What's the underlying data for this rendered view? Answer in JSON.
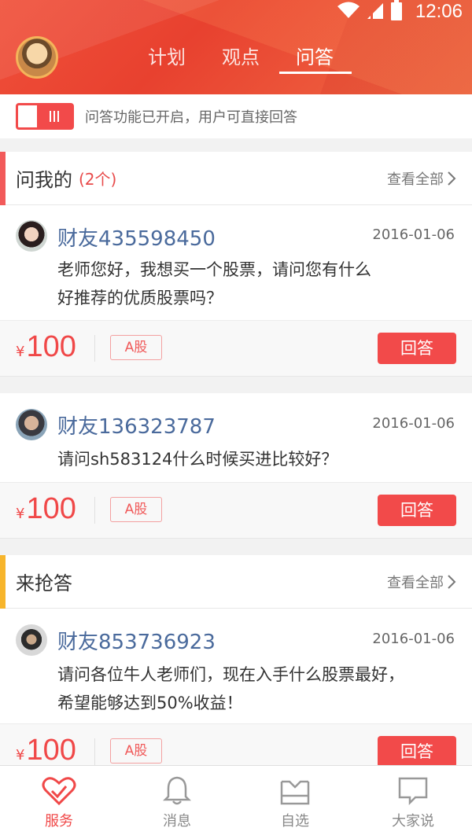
{
  "status_bar": {
    "time": "12:06"
  },
  "header": {
    "tabs": [
      {
        "label": "计划",
        "active": false
      },
      {
        "label": "观点",
        "active": false
      },
      {
        "label": "问答",
        "active": true
      }
    ]
  },
  "toggle": {
    "on": true,
    "text": "问答功能已开启，用户可直接回答"
  },
  "sections": [
    {
      "title": "问我的",
      "count": "(2个)",
      "view_all": "查看全部",
      "accent": "#f25a5a",
      "questions": [
        {
          "user": "财友435598450",
          "date": "2016-01-06",
          "text_lines": [
            "老师您好，我想买一个股票，请问您有什么",
            "好推荐的优质股票吗？"
          ],
          "yen": "¥",
          "price": "100",
          "tag": "A股",
          "action": "回答"
        },
        {
          "user": "财友136323787",
          "date": "2016-01-06",
          "text_lines": [
            "请问sh583124什么时候买进比较好？"
          ],
          "yen": "¥",
          "price": "100",
          "tag": "A股",
          "action": "回答"
        }
      ]
    },
    {
      "title": "来抢答",
      "count": "",
      "view_all": "查看全部",
      "accent": "#f7b52c",
      "questions": [
        {
          "user": "财友853736923",
          "date": "2016-01-06",
          "text_lines": [
            "请问各位牛人老师们，现在入手什么股票最好，",
            "希望能够达到50%收益！"
          ],
          "yen": "¥",
          "price": "100",
          "tag": "A股",
          "action": "回答"
        }
      ]
    }
  ],
  "bottom_nav": [
    {
      "label": "服务",
      "icon": "heart-hands-icon",
      "active": true
    },
    {
      "label": "消息",
      "icon": "bell-icon",
      "active": false
    },
    {
      "label": "自选",
      "icon": "inbox-icon",
      "active": false
    },
    {
      "label": "大家说",
      "icon": "chat-bubble-icon",
      "active": false
    }
  ],
  "colors": {
    "brand_red": "#f24a4a",
    "link_blue": "#4a6a9c",
    "accent_yellow": "#f7b52c"
  }
}
